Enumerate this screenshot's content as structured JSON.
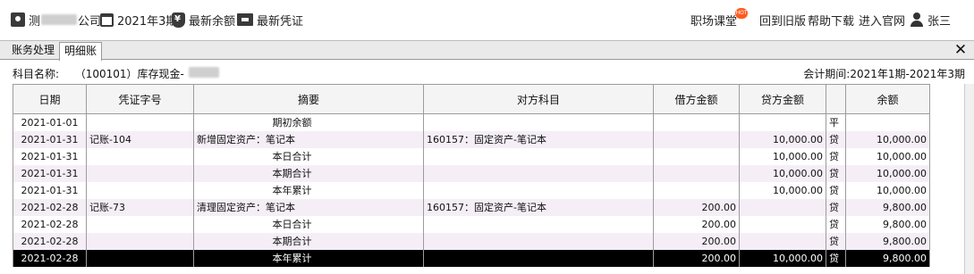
{
  "toolbar": {
    "company_prefix": "测",
    "company_suffix": "公司",
    "period": "2021年3期",
    "latest_balance": "最新余额",
    "latest_voucher": "最新凭证",
    "workplace_class": "职场课堂",
    "hot_badge": "HOT",
    "old_version": "回到旧版",
    "help_download": "帮助下载",
    "official_site": "进入官网",
    "user_name": "张三"
  },
  "tabs": [
    {
      "label": "账务处理"
    },
    {
      "label": "明细账"
    }
  ],
  "close_label": "✕",
  "info": {
    "subject_label": "科目名称:",
    "subject_value": "（100101）库存现金-",
    "period_label": "会计期间:",
    "period_value": "2021年1期-2021年3期"
  },
  "columns": [
    "日期",
    "凭证字号",
    "摘要",
    "对方科目",
    "借方金额",
    "贷方金额",
    "",
    "余额"
  ],
  "rows": [
    {
      "date": "2021-01-01",
      "voucher": "",
      "summary": "期初余额",
      "summary_align": "c",
      "counter": "",
      "debit": "",
      "credit": "",
      "dir": "平",
      "balance": ""
    },
    {
      "date": "2021-01-31",
      "voucher": "记账-104",
      "summary": "新增固定资产：笔记本",
      "summary_align": "l",
      "counter": "160157：固定资产-笔记本",
      "debit": "",
      "credit": "10,000.00",
      "dir": "贷",
      "balance": "10,000.00"
    },
    {
      "date": "2021-01-31",
      "voucher": "",
      "summary": "本日合计",
      "summary_align": "c",
      "counter": "",
      "debit": "",
      "credit": "10,000.00",
      "dir": "贷",
      "balance": "10,000.00"
    },
    {
      "date": "2021-01-31",
      "voucher": "",
      "summary": "本期合计",
      "summary_align": "c",
      "counter": "",
      "debit": "",
      "credit": "10,000.00",
      "dir": "贷",
      "balance": "10,000.00"
    },
    {
      "date": "2021-01-31",
      "voucher": "",
      "summary": "本年累计",
      "summary_align": "c",
      "counter": "",
      "debit": "",
      "credit": "10,000.00",
      "dir": "贷",
      "balance": "10,000.00"
    },
    {
      "date": "2021-02-28",
      "voucher": "记账-73",
      "summary": "清理固定资产：笔记本",
      "summary_align": "l",
      "counter": "160157：固定资产-笔记本",
      "debit": "200.00",
      "credit": "",
      "dir": "贷",
      "balance": "9,800.00"
    },
    {
      "date": "2021-02-28",
      "voucher": "",
      "summary": "本日合计",
      "summary_align": "c",
      "counter": "",
      "debit": "200.00",
      "credit": "",
      "dir": "贷",
      "balance": "9,800.00"
    },
    {
      "date": "2021-02-28",
      "voucher": "",
      "summary": "本期合计",
      "summary_align": "c",
      "counter": "",
      "debit": "200.00",
      "credit": "",
      "dir": "贷",
      "balance": "9,800.00"
    },
    {
      "date": "2021-02-28",
      "voucher": "",
      "summary": "本年累计",
      "summary_align": "c",
      "counter": "",
      "debit": "200.00",
      "credit": "10,000.00",
      "dir": "贷",
      "balance": "9,800.00",
      "selected": true
    }
  ]
}
